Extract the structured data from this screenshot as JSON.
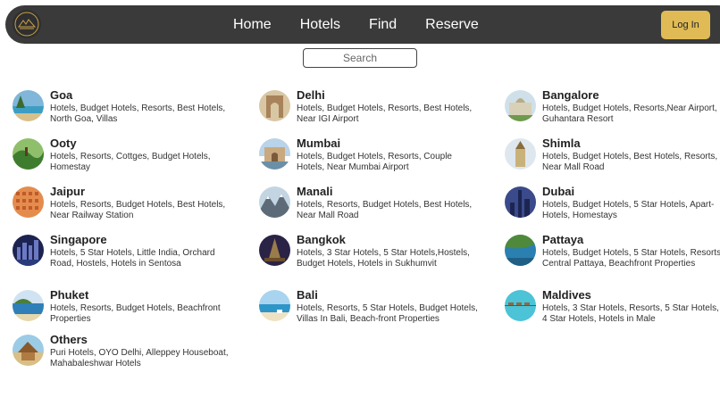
{
  "nav": {
    "links": [
      "Home",
      "Hotels",
      "Find",
      "Reserve"
    ],
    "login_label": "Log In"
  },
  "search": {
    "placeholder": "Search"
  },
  "colors": {
    "navbar": "#3a3a3a",
    "login": "#e0bb55",
    "logo_gold": "#c9a14a"
  },
  "cities": [
    {
      "name": "Goa",
      "desc": "Hotels, Budget Hotels, Resorts, Best Hotels, North Goa, Villas",
      "icon": "beach-thumbnail"
    },
    {
      "name": "Delhi",
      "desc": "Hotels, Budget Hotels, Resorts, Best Hotels, Near IGI Airport",
      "icon": "india-gate-thumbnail"
    },
    {
      "name": "Bangalore",
      "desc": "Hotels, Budget Hotels, Resorts,Near Airport, Guhantara Resort",
      "icon": "palace-thumbnail"
    },
    {
      "name": "Ooty",
      "desc": "Hotels, Resorts, Cottges, Budget Hotels, Homestay",
      "icon": "hills-thumbnail"
    },
    {
      "name": "Mumbai",
      "desc": "Hotels, Budget Hotels, Resorts, Couple Hotels, Near Mumbai Airport",
      "icon": "gateway-thumbnail"
    },
    {
      "name": "Shimla",
      "desc": "Hotels, Budget Hotels, Best Hotels, Resorts, Near Mall Road",
      "icon": "church-thumbnail"
    },
    {
      "name": "Jaipur",
      "desc": "Hotels, Resorts, Budget Hotels, Best Hotels, Near Railway Station",
      "icon": "hawa-mahal-thumbnail"
    },
    {
      "name": "Manali",
      "desc": "Hotels, Resorts, Budget Hotels, Best Hotels, Near Mall Road",
      "icon": "mountains-thumbnail"
    },
    {
      "name": "Dubai",
      "desc": "Hotels, Budget Hotels, 5 Star Hotels, Apart-Hotels, Homestays",
      "icon": "skyline-thumbnail"
    },
    {
      "name": "Singapore",
      "desc": "Hotels, 5 Star Hotels, Little India, Orchard Road, Hostels, Hotels in Sentosa",
      "icon": "night-city-thumbnail"
    },
    {
      "name": "Bangkok",
      "desc": "Hotels, 3 Star Hotels, 5 Star Hotels,Hostels, Budget Hotels, Hotels in Sukhumvit",
      "icon": "temple-thumbnail"
    },
    {
      "name": "Pattaya",
      "desc": "Hotels, Budget Hotels, 5 Star Hotels, Resorts, Central Pattaya, Beachfront Properties",
      "icon": "coast-thumbnail"
    },
    {
      "name": "Phuket",
      "desc": "Hotels, Resorts, Budget Hotels, Beachfront Properties",
      "icon": "sea-thumbnail"
    },
    {
      "name": "Bali",
      "desc": "Hotels, Resorts, 5 Star Hotels, Budget Hotels, Villas In Bali, Beach-front Properties",
      "icon": "bali-beach-thumbnail"
    },
    {
      "name": "Maldives",
      "desc": "Hotels, 3 Star Hotels, Resorts, 5 Star Hotels, 4 Star Hotels, Hotels in Male",
      "icon": "water-villa-thumbnail"
    },
    {
      "name": "Others",
      "desc": "Puri Hotels, OYO Delhi, Alleppey Houseboat, Mahabaleshwar Hotels",
      "icon": "hut-thumbnail"
    }
  ]
}
